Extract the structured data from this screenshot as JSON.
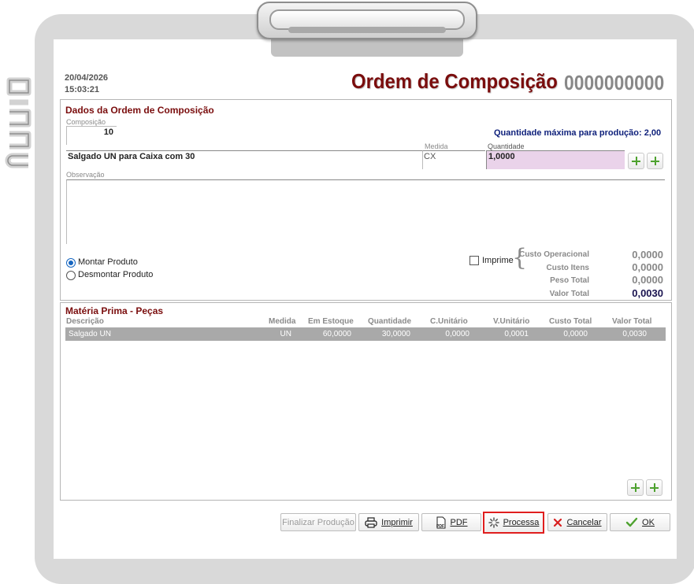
{
  "header": {
    "date": "20/04/2026",
    "time": "15:03:21",
    "title": "Ordem de Composição",
    "number": "0000000000"
  },
  "dados": {
    "title": "Dados da Ordem de Composição",
    "composicao_label": "Composição",
    "composicao_value": "10",
    "max_qty_text": "Quantidade máxima para produção: 2,00",
    "produto_value": "Salgado UN para Caixa com 30",
    "medida_label": "Medida",
    "medida_value": "CX",
    "quantidade_label": "Quantidade",
    "quantidade_value": "1,0000",
    "observacao_label": "Observação",
    "observacao_value": "",
    "radio_montar": "Montar Produto",
    "radio_desmontar": "Desmontar Produto",
    "selected_mode": "montar",
    "imprime_label": "Imprime",
    "imprime_checked": false,
    "costs": [
      {
        "label": "Custo Operacional",
        "value": "0,0000"
      },
      {
        "label": "Custo Itens",
        "value": "0,0000"
      },
      {
        "label": "Peso Total",
        "value": "0,0000"
      },
      {
        "label": "Valor Total",
        "value": "0,0030"
      }
    ]
  },
  "materia": {
    "title": "Matéria Prima - Peças",
    "columns": [
      "Descrição",
      "Medida",
      "Em Estoque",
      "Quantidade",
      "C.Unitário",
      "V.Unitário",
      "Custo Total",
      "Valor Total"
    ],
    "rows": [
      [
        "Salgado UN",
        "UN",
        "60,0000",
        "30,0000",
        "0,0000",
        "0,0001",
        "0,0000",
        "0,0030"
      ]
    ]
  },
  "buttons": {
    "finalizar": "Finalizar Produção",
    "imprimir": "Imprimir",
    "pdf": "PDF",
    "processa": "Processa",
    "cancelar": "Cancelar",
    "ok": "OK"
  },
  "colors": {
    "title": "#7a0d0d",
    "accent_blue": "#0d1f7a",
    "highlight": "#e05050",
    "selected_row": "#a9a9a9",
    "quantity_bg": "#ead3ea"
  },
  "icons": [
    "printer-icon",
    "pdf-icon",
    "spinner-icon",
    "close-icon",
    "check-icon",
    "plus-icon"
  ]
}
